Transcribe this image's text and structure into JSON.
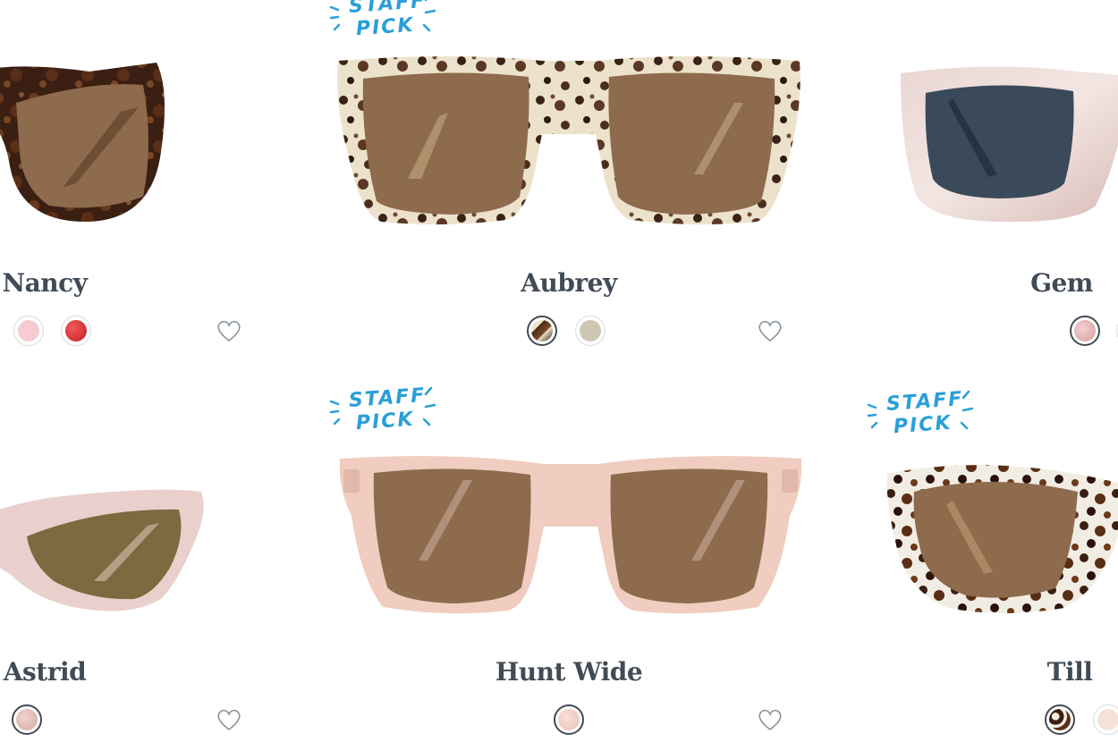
{
  "products": [
    {
      "name": "Nancy",
      "staff_pick": false
    },
    {
      "name": "Aubrey",
      "staff_pick": true
    },
    {
      "name": "Gem",
      "staff_pick": false
    },
    {
      "name": "Astrid",
      "staff_pick": false
    },
    {
      "name": "Hunt Wide",
      "staff_pick": true
    },
    {
      "name": "Till",
      "staff_pick": true
    }
  ],
  "badge": {
    "line1": "STAFF",
    "line2": "PICK"
  },
  "colors": {
    "text": "#414b56",
    "badge": "#2a9fd8",
    "lens_brown": "#8e6b4c",
    "lens_blue": "#3a4a5a",
    "lens_olive": "#7d6a40"
  },
  "icons": {
    "favorite": "heart-outline-icon"
  }
}
